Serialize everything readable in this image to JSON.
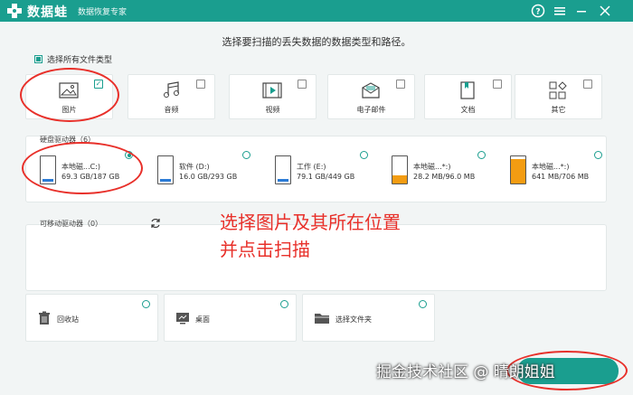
{
  "app": {
    "brand": "数据蛙",
    "subtitle": "数据恢复专家"
  },
  "colors": {
    "accent": "#1a9e8f",
    "annotation": "#e8302a",
    "drive_fill": "#f39c12"
  },
  "heading": "选择要扫描的丢失数据的数据类型和路径。",
  "select_all_label": "选择所有文件类型",
  "file_types": [
    {
      "label": "图片",
      "icon": "image-icon",
      "checked": true
    },
    {
      "label": "音频",
      "icon": "music-icon",
      "checked": false
    },
    {
      "label": "视频",
      "icon": "video-icon",
      "checked": false
    },
    {
      "label": "电子邮件",
      "icon": "mail-icon",
      "checked": false
    },
    {
      "label": "文档",
      "icon": "document-icon",
      "checked": false
    },
    {
      "label": "其它",
      "icon": "other-icon",
      "checked": false
    }
  ],
  "hard_drives": {
    "title": "硬盘驱动器（6）",
    "items": [
      {
        "name": "本地磁...C:)",
        "size": "69.3 GB/187 GB",
        "used_fraction": 0.37,
        "selected": true
      },
      {
        "name": "软件 (D:)",
        "size": "16.0 GB/293 GB",
        "used_fraction": 0.05,
        "selected": false
      },
      {
        "name": "工作 (E:)",
        "size": "79.1 GB/449 GB",
        "used_fraction": 0.18,
        "selected": false
      },
      {
        "name": "本地磁...*:)",
        "size": "28.2 MB/96.0 MB",
        "used_fraction": 0.29,
        "selected": false
      },
      {
        "name": "本地磁...*:)",
        "size": "641 MB/706 MB",
        "used_fraction": 0.91,
        "selected": false
      }
    ]
  },
  "removable": {
    "title": "可移动驱动器（0）"
  },
  "locations": [
    {
      "label": "回收站",
      "icon": "recycle-bin-icon"
    },
    {
      "label": "桌面",
      "icon": "desktop-icon"
    },
    {
      "label": "选择文件夹",
      "icon": "folder-icon"
    }
  ],
  "annotation": {
    "line1": "选择图片及其所在位置",
    "line2": "并点击扫描"
  },
  "watermark": "掘金技术社区 @ 晴朗姐姐"
}
